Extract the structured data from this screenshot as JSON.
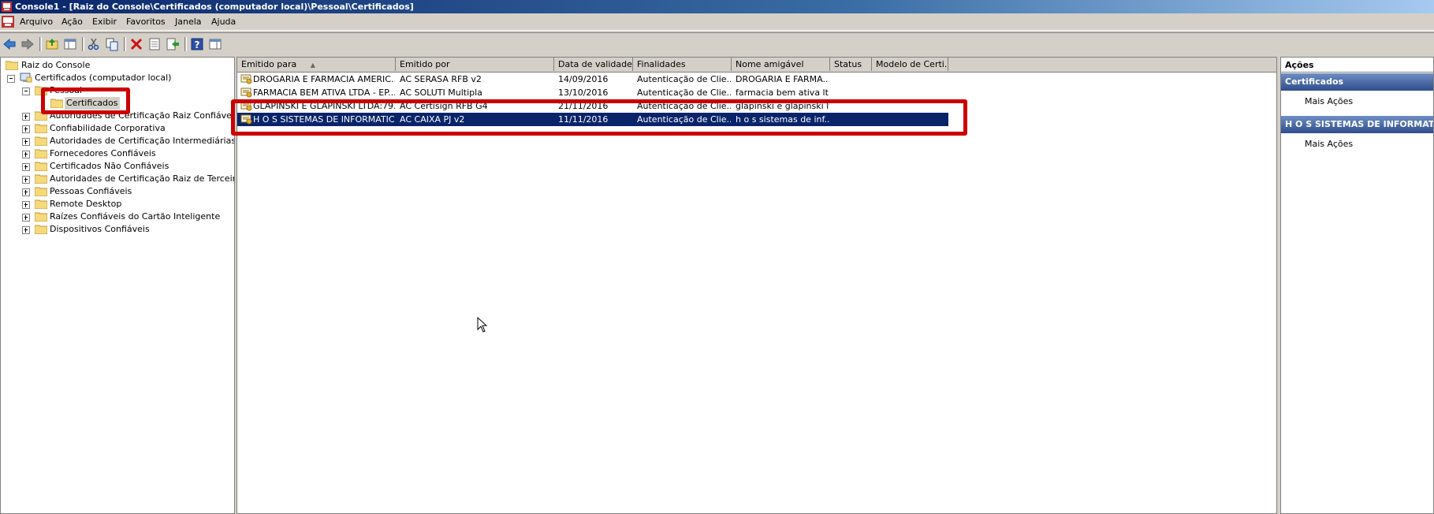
{
  "window": {
    "title": "Console1 - [Raiz do Console\\Certificados (computador local)\\Pessoal\\Certificados]"
  },
  "menu": [
    "Arquivo",
    "Ação",
    "Exibir",
    "Favoritos",
    "Janela",
    "Ajuda"
  ],
  "toolbar": {
    "icons": [
      "back-icon",
      "forward-icon",
      "up-folder-icon",
      "show-hide-tree-icon",
      "cut-icon",
      "copy-icon",
      "delete-icon",
      "properties-icon",
      "export-icon",
      "help-icon",
      "show-hide-action-pane-icon"
    ]
  },
  "tree": {
    "root": "Raiz do Console",
    "computer": "Certificados (computador local)",
    "pessoal": "Pessoal",
    "certificados": "Certificados",
    "items": [
      "Autoridades de Certificação Raiz Confiáveis",
      "Confiabilidade Corporativa",
      "Autoridades de Certificação Intermediárias",
      "Fornecedores Confiáveis",
      "Certificados Não Confiáveis",
      "Autoridades de Certificação Raiz de Terceiros",
      "Pessoas Confiáveis",
      "Remote Desktop",
      "Raízes Confiáveis do Cartão Inteligente",
      "Dispositivos Confiáveis"
    ]
  },
  "list": {
    "columns": [
      "Emitido para",
      "Emitido por",
      "Data de validade",
      "Finalidades",
      "Nome amigável",
      "Status",
      "Modelo de Certi..."
    ],
    "sort_indicator": "▲",
    "rows": [
      {
        "to": "DROGARIA E FARMACIA AMERIC...",
        "by": "AC SERASA RFB v2",
        "date": "14/09/2016",
        "purpose": "Autenticação de Clie...",
        "friendly": "DROGARIA E FARMA...",
        "status": "",
        "model": "",
        "selected": false
      },
      {
        "to": "FARMACIA BEM ATIVA LTDA - EP...",
        "by": "AC SOLUTI Multipla",
        "date": "13/10/2016",
        "purpose": "Autenticação de Clie...",
        "friendly": "farmacia bem ativa lt...",
        "status": "",
        "model": "",
        "selected": false
      },
      {
        "to": "GLAPINSKI E GLAPINSKI LTDA:79...",
        "by": "AC Certisign RFB G4",
        "date": "21/11/2016",
        "purpose": "Autenticação de Clie...",
        "friendly": "glapinski e glapinski lt...",
        "status": "",
        "model": "",
        "selected": false
      },
      {
        "to": "H O S SISTEMAS DE INFORMATIC...",
        "by": "AC CAIXA PJ v2",
        "date": "11/11/2016",
        "purpose": "Autenticação de Clie...",
        "friendly": "h o s sistemas de inf...",
        "status": "",
        "model": "",
        "selected": true
      }
    ]
  },
  "actions": {
    "header": "Ações",
    "sections": [
      {
        "title": "Certificados",
        "items": [
          "Mais Ações"
        ]
      },
      {
        "title": "H O S SISTEMAS DE INFORMATICA",
        "items": [
          "Mais Ações"
        ]
      }
    ]
  },
  "colors": {
    "selection": "#0a246a",
    "highlight": "#cc0000",
    "chrome": "#d4d0c8"
  }
}
